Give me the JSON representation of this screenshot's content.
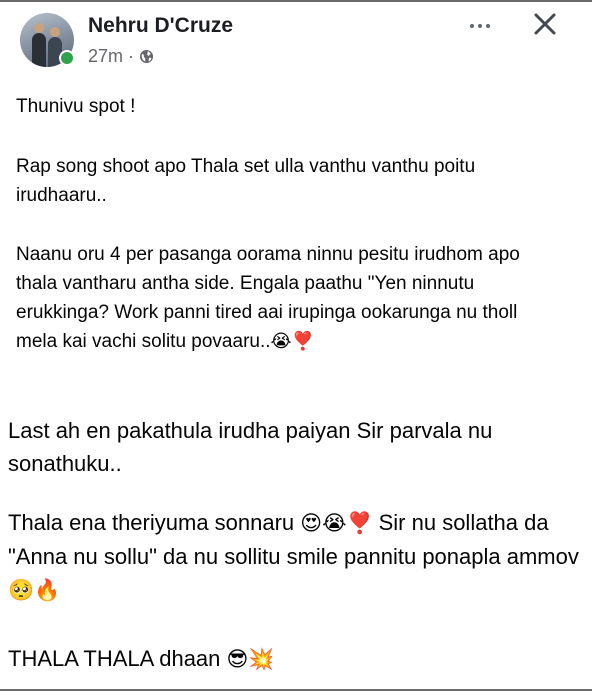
{
  "post": {
    "author": "Nehru D'Cruze",
    "time": "27m",
    "separator": "·",
    "paragraphs": [
      {
        "text": "Thunivu spot !",
        "emoji": ""
      },
      {
        "text": "Rap song shoot apo Thala set ulla vanthu vanthu poitu irudhaaru..",
        "emoji": ""
      },
      {
        "text": "Naanu oru 4 per pasanga oorama ninnu pesitu irudhom apo thala vantharu antha side. Engala paathu \"Yen ninnutu erukkinga? Work panni tired aai irupinga ookarunga nu tholl mela kai vachi solitu povaaru..",
        "emoji": "😭❣️"
      },
      {
        "text": "Last ah en pakathula irudha paiyan Sir parvala nu sonathuku..",
        "emoji": ""
      },
      {
        "text": "Thala ena theriyuma sonnaru ",
        "emoji": "😍😭❣️",
        "text2": " Sir nu sollatha da \"Anna nu sollu\" da nu sollitu smile pannitu ponapla ammov",
        "emoji2": "🥺🔥"
      },
      {
        "text": "THALA THALA dhaan ",
        "emoji": "😎💥"
      }
    ]
  },
  "icons": {
    "audience": "globe-icon",
    "more": "more-options-icon",
    "close": "close-icon",
    "status": "online-status-icon"
  },
  "colors": {
    "text": "#050505",
    "meta": "#65676b",
    "online": "#31a24c"
  }
}
